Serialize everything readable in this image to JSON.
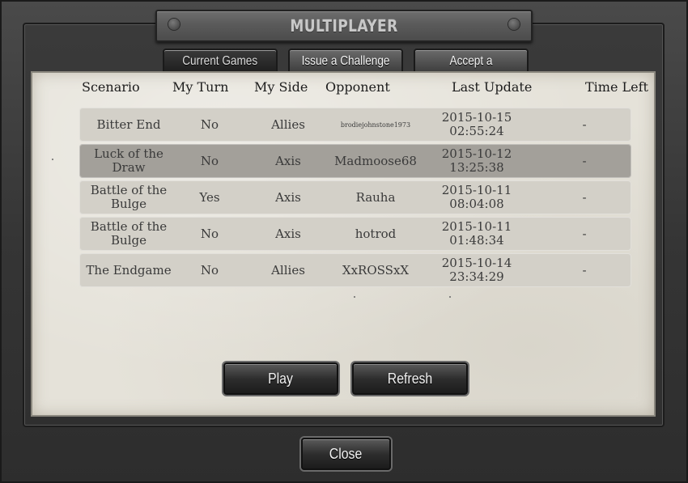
{
  "window": {
    "title": "MULTIPLAYER"
  },
  "tabs": [
    {
      "label": "Current Games",
      "active": true
    },
    {
      "label": "Issue a Challenge",
      "active": false
    },
    {
      "label": "Accept a Challenge",
      "active": false
    }
  ],
  "table": {
    "columns": [
      "Scenario",
      "My Turn",
      "My Side",
      "Opponent",
      "Last Update",
      "Time Left"
    ],
    "rows": [
      {
        "scenario": "Bitter End",
        "my_turn": "No",
        "my_side": "Allies",
        "opponent": "brodiejohnstone1973",
        "date": "2015-10-15",
        "time": "02:55:24",
        "time_left": "-",
        "selected": false
      },
      {
        "scenario": "Luck of the Draw",
        "my_turn": "No",
        "my_side": "Axis",
        "opponent": "Madmoose68",
        "date": "2015-10-12",
        "time": "13:25:38",
        "time_left": "-",
        "selected": true
      },
      {
        "scenario": "Battle of the Bulge",
        "my_turn": "Yes",
        "my_side": "Axis",
        "opponent": "Rauha",
        "date": "2015-10-11",
        "time": "08:04:08",
        "time_left": "-",
        "selected": false
      },
      {
        "scenario": "Battle of the Bulge",
        "my_turn": "No",
        "my_side": "Axis",
        "opponent": "hotrod",
        "date": "2015-10-11",
        "time": "01:48:34",
        "time_left": "-",
        "selected": false
      },
      {
        "scenario": "The Endgame",
        "my_turn": "No",
        "my_side": "Allies",
        "opponent": "XxROSSxX",
        "date": "2015-10-14",
        "time": "23:34:29",
        "time_left": "-",
        "selected": false
      }
    ]
  },
  "buttons": {
    "play": "Play",
    "refresh": "Refresh",
    "close": "Close"
  },
  "colors": {
    "paper": "#e5e2d9",
    "row": "#d3d0c8",
    "row_selected": "#a3a09a",
    "frame": "#353535"
  }
}
